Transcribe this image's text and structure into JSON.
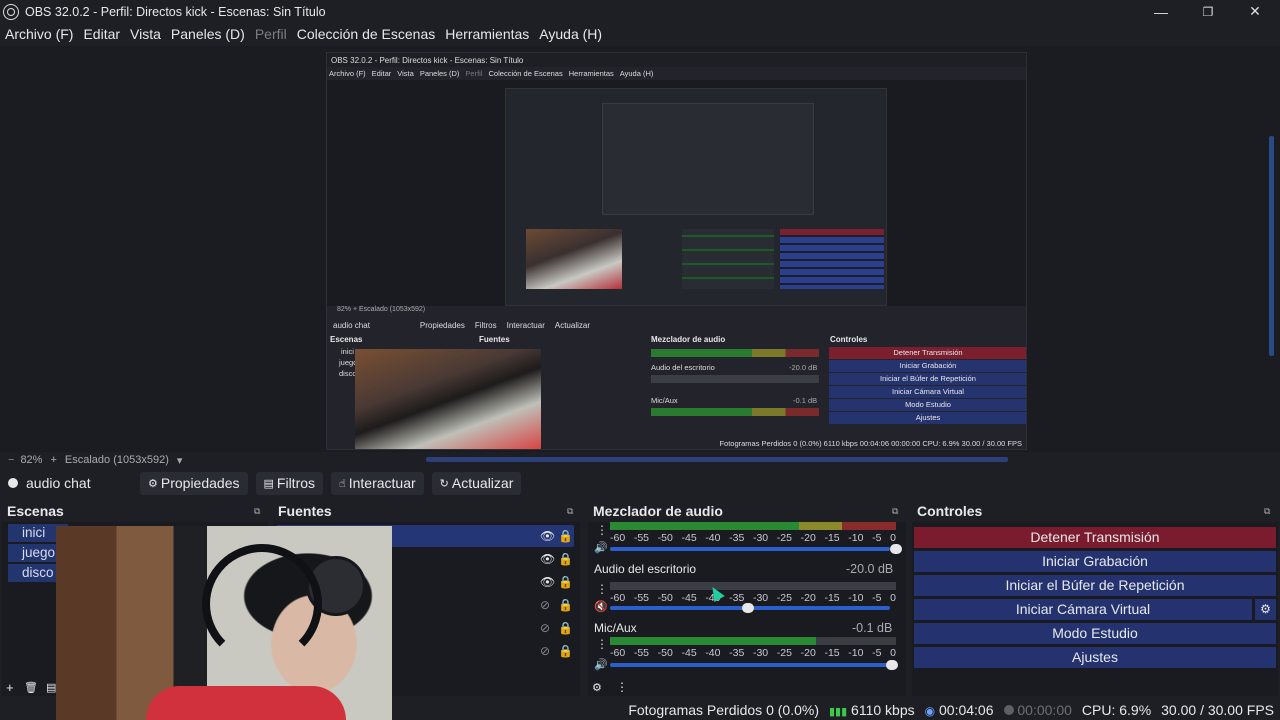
{
  "window": {
    "title": "OBS 32.0.2 - Perfil: Directos kick - Escenas: Sin Título",
    "minimize": "—",
    "restore": "❐",
    "close": "✕"
  },
  "menu": [
    "Archivo (F)",
    "Editar",
    "Vista",
    "Paneles (D)",
    "Perfil",
    "Colección de Escenas",
    "Herramientas",
    "Ayuda (H)"
  ],
  "inner": {
    "title": "OBS 32.0.2 - Perfil: Directos kick - Escenas: Sin Título",
    "menu": [
      "Archivo (F)",
      "Editar",
      "Vista",
      "Paneles (D)",
      "Perfil",
      "Colección de Escenas",
      "Herramientas",
      "Ayuda (H)"
    ],
    "zoom": "82%  +  Escalado (1053x592)",
    "toolbar": [
      "audio chat",
      "Propiedades",
      "Filtros",
      "Interactuar",
      "Actualizar"
    ],
    "docks": [
      "Escenas",
      "Fuentes",
      "Mezclador de audio",
      "Controles"
    ],
    "scenes": [
      "inici",
      "juego",
      "disco"
    ],
    "mixer": [
      "Audio del escritorio",
      "-20.0 dB",
      "Mic/Aux",
      "-0.1 dB"
    ],
    "controls": [
      "Detener Transmisión",
      "Iniciar Grabación",
      "Iniciar el Búfer de Repetición",
      "Iniciar Cámara Virtual",
      "Modo Estudio",
      "Ajustes"
    ],
    "status": "Fotogramas Perdidos 0 (0.0%)   6110 kbps   00:04:06   00:00:00   CPU: 6.9%   30.00 / 30.00 FPS"
  },
  "zoom": {
    "level": "82%",
    "plus": "+",
    "scaling": "Escalado (1053x592)",
    "dropdown": "▾"
  },
  "source_toolbar": {
    "source_name": "audio chat",
    "buttons": {
      "properties": "Propiedades",
      "filters": "Filtros",
      "interact": "Interactuar",
      "refresh": "Actualizar"
    }
  },
  "docks": {
    "scenes": {
      "title": "Escenas",
      "items": [
        "inici",
        "juego",
        "disco"
      ]
    },
    "sources": {
      "title": "Fuentes",
      "rows": 7
    },
    "mixer": {
      "title": "Mezclador de audio",
      "scale": [
        "-60",
        "-55",
        "-50",
        "-45",
        "-40",
        "-35",
        "-30",
        "-25",
        "-20",
        "-15",
        "-10",
        "-5",
        "0"
      ],
      "channels": [
        {
          "name": "",
          "db": "",
          "level": 1.0,
          "fader": 1.0,
          "muted": false
        },
        {
          "name": "Audio del escritorio",
          "db": "-20.0 dB",
          "level": 0.0,
          "fader": 0.47,
          "muted": true
        },
        {
          "name": "Mic/Aux",
          "db": "-0.1 dB",
          "level": 0.72,
          "fader": 0.98,
          "muted": false
        }
      ]
    },
    "controls": {
      "title": "Controles",
      "buttons": [
        "Detener Transmisión",
        "Iniciar Grabación",
        "Iniciar el Búfer de Repetición",
        "Iniciar Cámara Virtual",
        "Modo Estudio",
        "Ajustes"
      ]
    }
  },
  "status": {
    "dropped_frames": "Fotogramas Perdidos 0 (0.0%)",
    "bitrate": "6110 kbps",
    "stream_time": "00:04:06",
    "rec_time": "00:00:00",
    "cpu": "CPU: 6.9%",
    "fps": "30.00 / 30.00 FPS"
  },
  "colors": {
    "accent": "#243370",
    "stream_active": "#7b1c2e",
    "background": "#1e1f24"
  }
}
